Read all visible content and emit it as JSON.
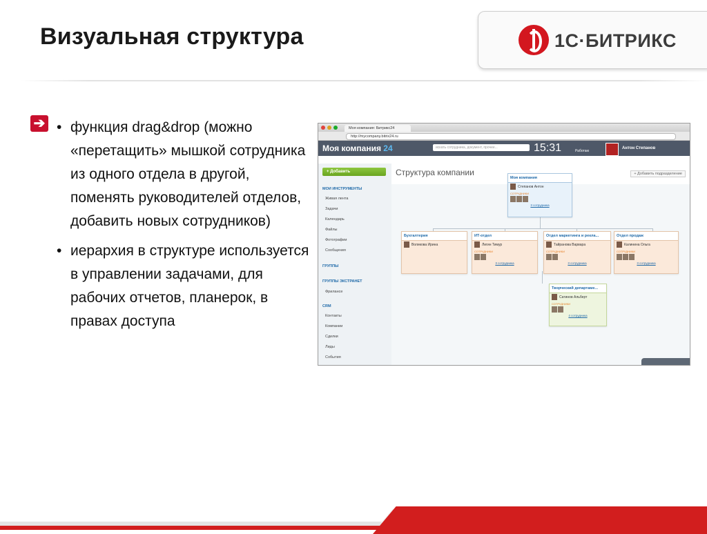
{
  "slide": {
    "title": "Визуальная структура",
    "logo_text": "1С·БИТРИКС",
    "bullets": [
      "функция drag&drop (можно «перетащить» мышкой сотрудника из одного отдела в другой, поменять руководителей отделов, добавить новых сотрудников)",
      "иерархия в структуре используется в управлении задачами, для рабочих отчетов, планерок, в правах доступа"
    ]
  },
  "screenshot": {
    "tab_title": "Моя компания: Битрикс24",
    "url": "http://mycompany.bitrix24.ru",
    "company": "Моя компания",
    "company_num": "24",
    "search_placeholder": "искать сотрудника, документ, прочее...",
    "clock": "15:31",
    "work_status": "Работаю",
    "user": "Антон Степанов",
    "add_button": "Добавить",
    "page_title": "Структура компании",
    "add_dept_button": "+ Добавить подразделение",
    "sidebar": {
      "sec1": "МОИ ИНСТРУМЕНТЫ",
      "items1": [
        "Живая лента",
        "Задачи",
        "Календарь",
        "Файлы",
        "Фотографии",
        "Сообщения"
      ],
      "sec2": "ГРУППЫ",
      "sec3": "ГРУППЫ ЭКСТРАНЕТ",
      "items3": [
        "Фрилансе"
      ],
      "sec4": "CRM",
      "items4": [
        "Контакты",
        "Компании",
        "Сделки",
        "Лиды",
        "События"
      ]
    },
    "org": {
      "root": {
        "title": "Моя компания",
        "head": "Степанов Антон",
        "staff_label": "СОТРУДНИКИ",
        "count": "3 сотрудника"
      },
      "depts": [
        {
          "title": "Бухгалтерия",
          "head": "Воликова Ирина",
          "staff_label": "",
          "count": ""
        },
        {
          "title": "ИТ-отдел",
          "head": "Лигин Тимур",
          "staff_label": "СОТРУДНИКИ",
          "count": "3 сотрудника"
        },
        {
          "title": "Отдел маркетинга и рекла...",
          "head": "Тайранова Варвара",
          "staff_label": "СОТРУДНИКИ",
          "count": "3 сотрудника"
        },
        {
          "title": "Отдел продаж",
          "head": "Калинина Ольга",
          "staff_label": "СОТРУДНИКИ",
          "count": "3 сотрудника"
        }
      ],
      "sub": {
        "title": "Творческий департаме...",
        "head": "Сатинов Альберт",
        "staff_label": "СОТРУДНИКИ",
        "count": "4 сотрудника"
      }
    }
  },
  "colors": {
    "accent_red": "#d3171f",
    "link_blue": "#1e69a8",
    "header_dark": "#4e5868"
  }
}
